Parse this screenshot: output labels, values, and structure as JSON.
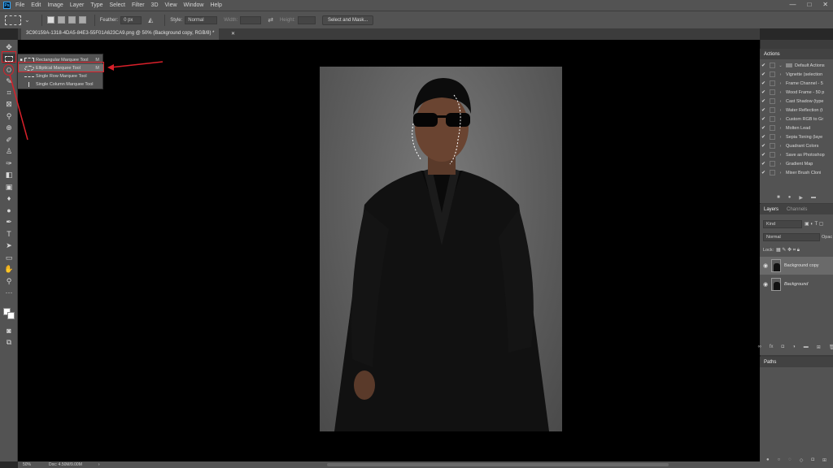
{
  "menu": [
    "File",
    "Edit",
    "Image",
    "Layer",
    "Type",
    "Select",
    "Filter",
    "3D",
    "View",
    "Window",
    "Help"
  ],
  "app_logo": "Ps",
  "window_controls": [
    "—",
    "□",
    "✕"
  ],
  "options": {
    "feather_label": "Feather:",
    "feather_value": "0 px",
    "style_label": "Style:",
    "style_value": "Normal",
    "width_label": "Width:",
    "height_label": "Height:",
    "select_mask": "Select and Mask..."
  },
  "document": {
    "tab_title": "3C90159A-1318-4DA5-84E3-55F01A623CA9.png @ 50% (Background copy, RGB/8) *"
  },
  "status": {
    "zoom": "50%",
    "doc": "Doc: 4.50M/9.00M"
  },
  "flyout": [
    {
      "label": "Rectangular Marquee Tool",
      "key": "M",
      "checked": true
    },
    {
      "label": "Elliptical Marquee Tool",
      "key": "M",
      "checked": false
    },
    {
      "label": "Single Row Marquee Tool",
      "key": "",
      "checked": false
    },
    {
      "label": "Single Column Marquee Tool",
      "key": "",
      "checked": false
    }
  ],
  "actions": {
    "tab": "Actions",
    "items": [
      "Default Actions",
      "Vignette (selection",
      "Frame Channel - 5",
      "Wood Frame - 50 p",
      "Cast Shadow (type",
      "Water Reflection (t",
      "Custom RGB to Gr",
      "Molten Lead",
      "Sepia Toning (laye",
      "Quadrant Colors",
      "Save as Photoshop",
      "Gradient Map",
      "Mixer Brush Cloni"
    ]
  },
  "layers": {
    "tabs": [
      "Layers",
      "Channels"
    ],
    "kind": "Kind",
    "blend": "Normal",
    "opacity_label": "Opac",
    "lock_label": "Lock:",
    "items": [
      {
        "name": "Background copy",
        "selected": true
      },
      {
        "name": "Background",
        "selected": false
      }
    ]
  },
  "paths": {
    "tab": "Paths"
  },
  "colors": {
    "annotation": "#d8202a"
  }
}
